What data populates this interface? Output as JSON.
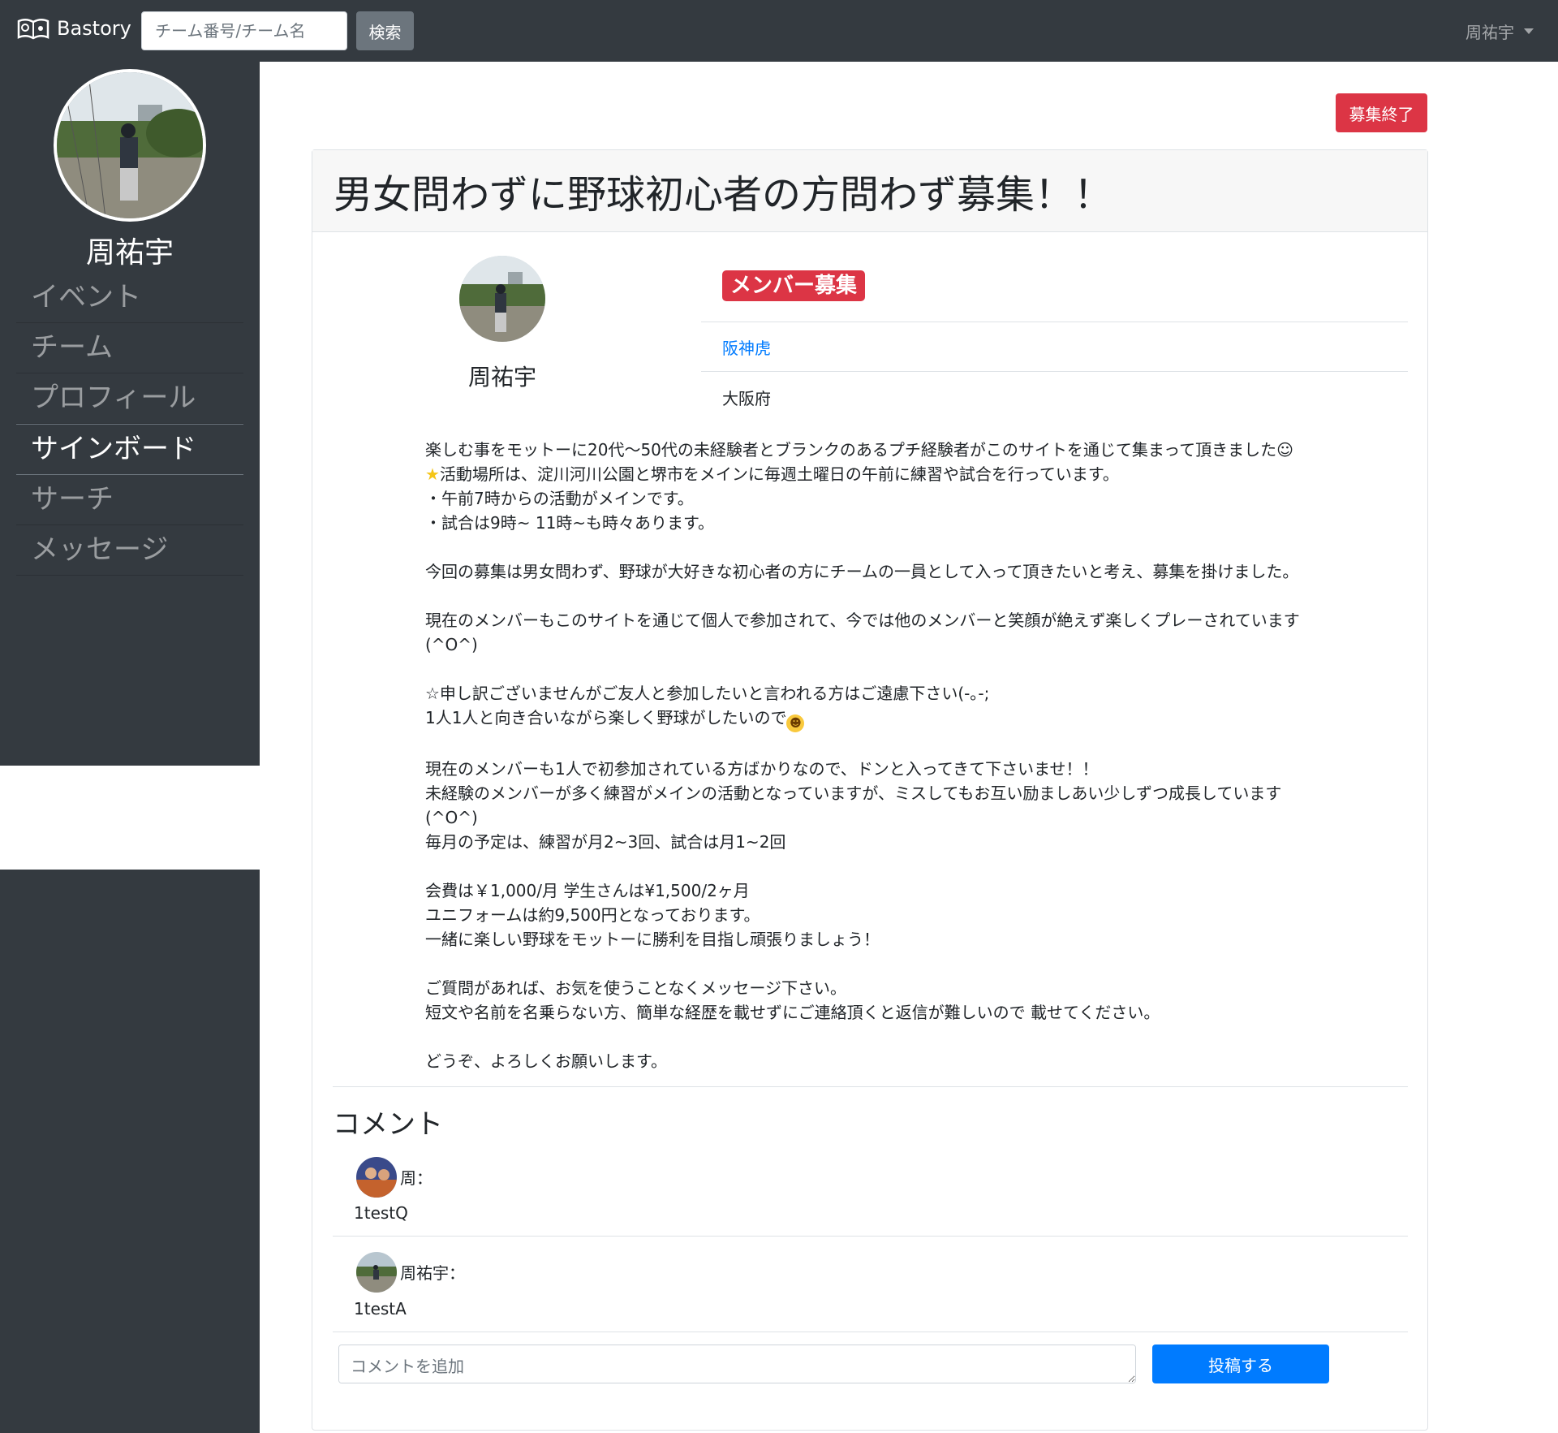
{
  "navbar": {
    "brand": "Bastory",
    "search_placeholder": "チーム番号/チーム名",
    "search_button": "検索",
    "user_name": "周祐宇"
  },
  "sidebar": {
    "user_name": "周祐宇",
    "items": [
      {
        "label": "イベント"
      },
      {
        "label": "チーム"
      },
      {
        "label": "プロフィール"
      },
      {
        "label": "サインボード"
      },
      {
        "label": "サーチ"
      },
      {
        "label": "メッセージ"
      }
    ]
  },
  "post": {
    "end_button": "募集終了",
    "title": "男女問わずに野球初心者の方問わず募集！！",
    "author_name": "周祐宇",
    "type_badge": "メンバー募集",
    "team_name": "阪神虎",
    "prefecture": "大阪府",
    "description": {
      "l1": "楽しむ事をモットーに20代〜50代の未経験者とブランクのあるプチ経験者がこのサイトを通じて集まって頂きました☺",
      "l2": "活動場所は、淀川河川公園と堺市をメインに毎週土曜日の午前に練習や試合を行っています。",
      "l3": "・午前7時からの活動がメインです。",
      "l4": "・試合は9時~ 11時~も時々あります。",
      "l5": "今回の募集は男女問わず、野球が大好きな初心者の方にチームの一員として入って頂きたいと考え、募集を掛けました。",
      "l6": "現在のメンバーもこのサイトを通じて個人で参加されて、今では他のメンバーと笑顔が絶えず楽しくプレーされています",
      "l7": "(^O^)",
      "l8": "☆申し訳ございませんがご友人と参加したいと言われる方はご遠慮下さい(-｡-;",
      "l9": "1人1人と向き合いながら楽しく野球がしたいので",
      "l10": "現在のメンバーも1人で初参加されている方ばかりなので、ドンと入ってきて下さいませ！！",
      "l11": "未経験のメンバーが多く練習がメインの活動となっていますが、ミスしてもお互い励ましあい少しずつ成長しています",
      "l12": "(^O^)",
      "l13": "毎月の予定は、練習が月2~3回、試合は月1~2回",
      "l14": "会費は￥1,000/月 学生さんは¥1,500/2ヶ月",
      "l15": "ユニフォームは約9,500円となっております。",
      "l16": "一緒に楽しい野球をモットーに勝利を目指し頑張りましょう！",
      "l17": "ご質問があれば、お気を使うことなくメッセージ下さい。",
      "l18": "短文や名前を名乗らない方、簡単な経歴を載せずにご連絡頂くと返信が難しいので 載せてください。",
      "l19": "どうぞ、よろしくお願いします。"
    }
  },
  "comments": {
    "heading": "コメント",
    "items": [
      {
        "author": "周：",
        "text": "1testQ"
      },
      {
        "author": "周祐宇：",
        "text": "1testA"
      }
    ],
    "input_placeholder": "コメントを追加",
    "post_button": "投稿する"
  },
  "colors": {
    "navbar_bg": "#343a40",
    "danger": "#dc3545",
    "primary": "#007bff"
  },
  "icons": [
    "book-logo-icon",
    "caret-down-icon",
    "star-icon",
    "smile-icon"
  ]
}
